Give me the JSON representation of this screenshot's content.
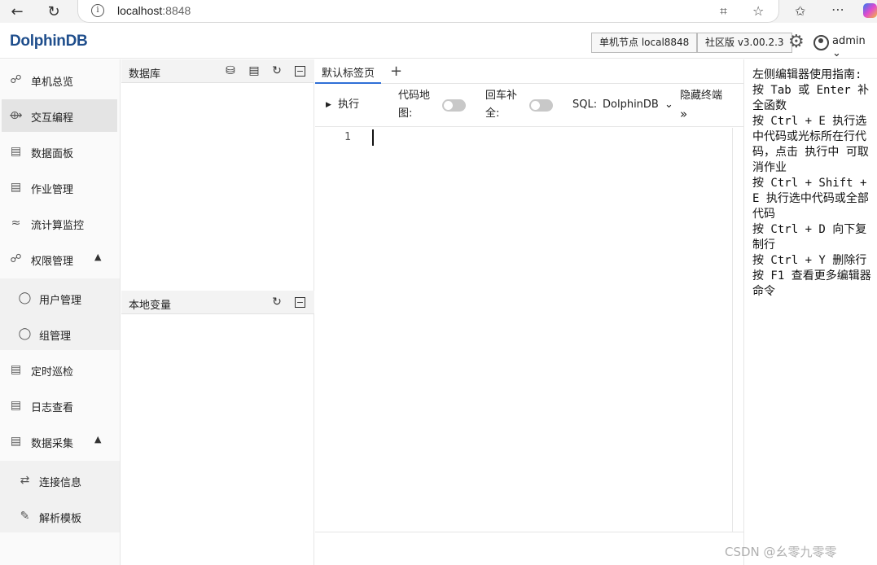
{
  "browser": {
    "url_host": "localhost",
    "url_port": ":8848"
  },
  "header": {
    "logo": "DolphinDB",
    "node_button": "单机节点 local8848",
    "edition_button": "社区版 v3.00.2.3",
    "user": "admin"
  },
  "sidebar": {
    "items": [
      {
        "label": "单机总览"
      },
      {
        "label": "交互编程"
      },
      {
        "label": "数据面板"
      },
      {
        "label": "作业管理"
      },
      {
        "label": "流计算监控"
      },
      {
        "label": "权限管理"
      },
      {
        "label": "用户管理"
      },
      {
        "label": "组管理"
      },
      {
        "label": "定时巡检"
      },
      {
        "label": "日志查看"
      },
      {
        "label": "数据采集"
      },
      {
        "label": "连接信息"
      },
      {
        "label": "解析模板"
      }
    ]
  },
  "db_panel": {
    "title": "数据库",
    "vars_title": "本地变量"
  },
  "editor": {
    "tab_label": "默认标签页",
    "run_label": "执行",
    "code_map_line1": "代码地",
    "code_map_line2": "图:",
    "enter_line1": "回车补",
    "enter_line2": "全:",
    "sql_label": "SQL:",
    "sql_value": "DolphinDB",
    "hide_terminal": "隐藏终端",
    "line_number": "1"
  },
  "guide": {
    "text": "左侧编辑器使用指南:\n按 Tab 或 Enter 补全函数\n按 Ctrl + E 执行选中代码或光标所在行代码，点击 执行中 可取消作业\n按 Ctrl + Shift + E 执行选中代码或全部代码\n按 Ctrl + D 向下复制行\n按 Ctrl + Y 删除行\n按 F1 查看更多编辑器命令"
  },
  "watermark": "CSDN @幺零九零零"
}
